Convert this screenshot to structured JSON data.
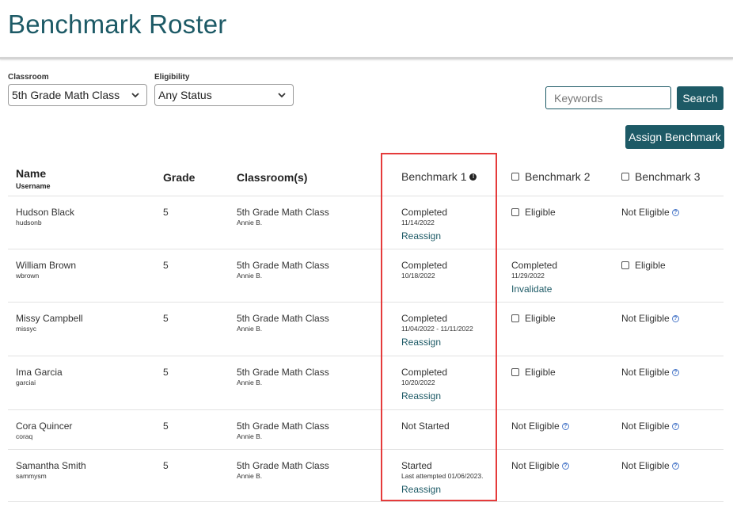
{
  "page": {
    "title": "Benchmark Roster"
  },
  "filters": {
    "classroom": {
      "label": "Classroom",
      "value": "5th Grade Math Class"
    },
    "eligibility": {
      "label": "Eligibility",
      "value": "Any Status"
    }
  },
  "search": {
    "placeholder": "Keywords",
    "button": "Search"
  },
  "actions": {
    "assign": "Assign Benchmark"
  },
  "table": {
    "headers": {
      "name": "Name",
      "username": "Username",
      "grade": "Grade",
      "classrooms": "Classroom(s)",
      "benchmark1": "Benchmark 1",
      "benchmark2": "Benchmark 2",
      "benchmark3": "Benchmark 3"
    },
    "rows": [
      {
        "name": "Hudson Black",
        "username": "hudsonb",
        "grade": "5",
        "classroom": "5th Grade Math Class",
        "teacher": "Annie B.",
        "b1": {
          "status": "Completed",
          "date": "11/14/2022",
          "link": "Reassign"
        },
        "b2": {
          "status": "Eligible",
          "checkbox": true
        },
        "b3": {
          "status": "Not Eligible",
          "info": true
        }
      },
      {
        "name": "William Brown",
        "username": "wbrown",
        "grade": "5",
        "classroom": "5th Grade Math Class",
        "teacher": "Annie B.",
        "b1": {
          "status": "Completed",
          "date": "10/18/2022"
        },
        "b2": {
          "status": "Completed",
          "date": "11/29/2022",
          "link": "Invalidate"
        },
        "b3": {
          "status": "Eligible",
          "checkbox": true
        }
      },
      {
        "name": "Missy Campbell",
        "username": "missyc",
        "grade": "5",
        "classroom": "5th Grade Math Class",
        "teacher": "Annie B.",
        "b1": {
          "status": "Completed",
          "date": "11/04/2022 - 11/11/2022",
          "link": "Reassign"
        },
        "b2": {
          "status": "Eligible",
          "checkbox": true
        },
        "b3": {
          "status": "Not Eligible",
          "info": true
        }
      },
      {
        "name": "Ima Garcia",
        "username": "garciai",
        "grade": "5",
        "classroom": "5th Grade Math Class",
        "teacher": "Annie B.",
        "b1": {
          "status": "Completed",
          "date": "10/20/2022",
          "link": "Reassign"
        },
        "b2": {
          "status": "Eligible",
          "checkbox": true
        },
        "b3": {
          "status": "Not Eligible",
          "info": true
        }
      },
      {
        "name": "Cora Quincer",
        "username": "coraq",
        "grade": "5",
        "classroom": "5th Grade Math Class",
        "teacher": "Annie B.",
        "b1": {
          "status": "Not Started"
        },
        "b2": {
          "status": "Not Eligible",
          "info": true
        },
        "b3": {
          "status": "Not Eligible",
          "info": true
        }
      },
      {
        "name": "Samantha Smith",
        "username": "sammysm",
        "grade": "5",
        "classroom": "5th Grade Math Class",
        "teacher": "Annie B.",
        "b1": {
          "status": "Started",
          "date": "Last attempted 01/06/2023.",
          "link": "Reassign"
        },
        "b2": {
          "status": "Not Eligible",
          "info": true
        },
        "b3": {
          "status": "Not Eligible",
          "info": true
        }
      }
    ]
  },
  "colors": {
    "brand": "#1d5a66",
    "highlight": "#e53b3b",
    "info": "#4a78c9"
  }
}
